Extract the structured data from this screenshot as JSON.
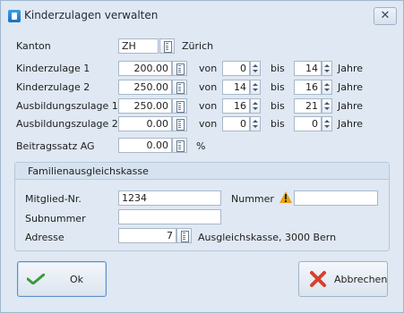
{
  "window": {
    "title": "Kinderzulagen verwalten",
    "close_glyph": "✕"
  },
  "colors": {
    "background": "#dfe8f3",
    "border": "#9fb6cf",
    "ok_check": "#3a9a3a",
    "cancel_x": "#d8402a",
    "warning": "#e6a117"
  },
  "kanton": {
    "label": "Kanton",
    "code": "ZH",
    "name": "Zürich"
  },
  "connectors": {
    "von": "von",
    "bis": "bis",
    "unit": "Jahre"
  },
  "rows": [
    {
      "label": "Kinderzulage 1",
      "amount": "200.00",
      "from": "0",
      "to": "14"
    },
    {
      "label": "Kinderzulage 2",
      "amount": "250.00",
      "from": "14",
      "to": "16"
    },
    {
      "label": "Ausbildungszulage 1",
      "amount": "250.00",
      "from": "16",
      "to": "21"
    },
    {
      "label": "Ausbildungszulage 2",
      "amount": "0.00",
      "from": "0",
      "to": "0"
    }
  ],
  "beitragssatz": {
    "label": "Beitragssatz AG",
    "value": "0.00",
    "unit": "%"
  },
  "fak": {
    "title": "Familienausgleichskasse",
    "mitglied_label": "Mitglied-Nr.",
    "mitglied_value": "1234",
    "nummer_label": "Nummer",
    "nummer_value": "",
    "subnummer_label": "Subnummer",
    "subnummer_value": "",
    "adresse_label": "Adresse",
    "adresse_value": "7",
    "adresse_text": "Ausgleichskasse, 3000 Bern"
  },
  "buttons": {
    "ok": "Ok",
    "cancel": "Abbrechen"
  },
  "icons": {
    "app": "app-icon",
    "close": "close-icon",
    "calc": "calculator-icon",
    "warn": "warning-icon",
    "ok": "checkmark-icon",
    "cancel": "x-icon"
  }
}
